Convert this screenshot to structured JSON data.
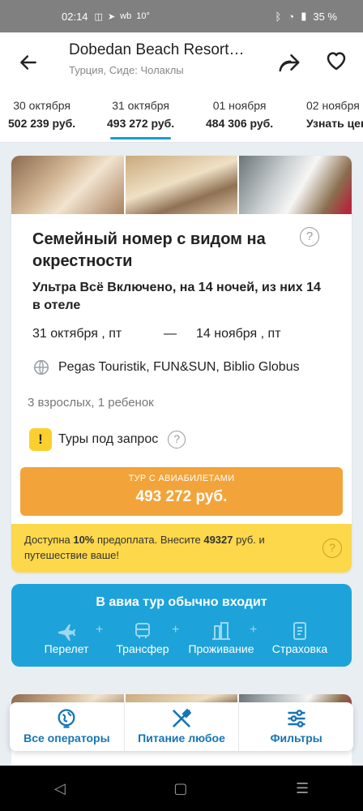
{
  "status": {
    "time": "02:14",
    "temp": "10°",
    "battery": "35 %",
    "wb": "wb"
  },
  "header": {
    "title": "Dobedan Beach Resort…",
    "subtitle": "Турция, Сиде: Чолаклы"
  },
  "dates": [
    {
      "date": "30 октября",
      "price": "502 239 руб."
    },
    {
      "date": "31 октября",
      "price": "493 272 руб.",
      "active": true
    },
    {
      "date": "01 ноября",
      "price": "484 306 руб."
    },
    {
      "date": "02 ноября",
      "price": "Узнать цену"
    }
  ],
  "offer": {
    "room": "Семейный номер с видом на окрестности",
    "meal": "Ультра Всё Включено, на 14 ночей, из них 14 в отеле",
    "date_from": "31 октября , пт",
    "dash": "—",
    "date_to": "14 ноября , пт",
    "operators": "Pegas Touristik, FUN&SUN, Biblio Globus",
    "pax": "3 взрослых, 1 ребенок",
    "request": "Туры под запрос",
    "price_caption": "ТУР С АВИАБИЛЕТАМИ",
    "price": "493 272 руб.",
    "prepay_pre": "Доступна ",
    "prepay_pct": "10%",
    "prepay_mid": " предоплата. Внесите ",
    "prepay_sum": "49327",
    "prepay_post": " руб. и путешествие ваше!"
  },
  "included": {
    "title": "В авиа тур обычно входит",
    "items": [
      "Перелет",
      "Трансфер",
      "Проживание",
      "Страховка"
    ]
  },
  "actions": [
    "Все операторы",
    "Питание любое",
    "Фильтры"
  ],
  "colors": {
    "accent": "#1da3d9",
    "price": "#f2a43a",
    "prepay": "#fcd84a",
    "action": "#1774b5"
  }
}
